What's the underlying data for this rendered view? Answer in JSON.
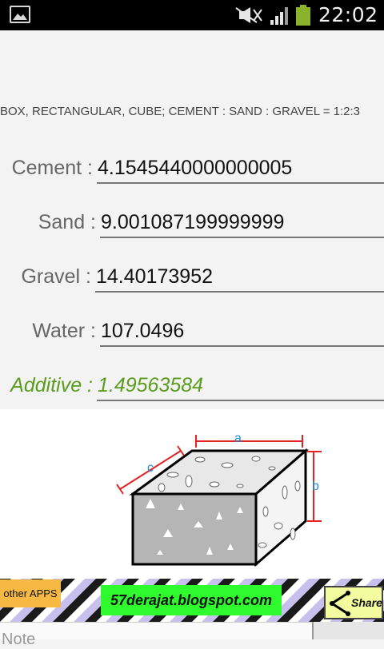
{
  "status_bar": {
    "time": "22:02",
    "battery_color": "#8ab32b",
    "icons": [
      "gallery-icon",
      "mute-icon",
      "signal-icon",
      "battery-icon"
    ]
  },
  "header": {
    "text": "BOX, RECTANGULAR, CUBE; CEMENT : SAND : GRAVEL = 1:2:3"
  },
  "results": {
    "cement": {
      "label": "Cement :",
      "value": "4.1545440000000005"
    },
    "sand": {
      "label": "Sand :",
      "value": "9.001087199999999"
    },
    "gravel": {
      "label": "Gravel :",
      "value": "14.40173952"
    },
    "water": {
      "label": "Water :",
      "value": "107.0496"
    },
    "additive": {
      "label": "Additive :",
      "value": "1.49563584"
    }
  },
  "diagram": {
    "label_a": "a",
    "label_b": "b",
    "label_c": "c"
  },
  "ad_bar": {
    "other_apps": "other APPS",
    "blog": "57derajat.blogspot.com",
    "share": "Share"
  },
  "note": {
    "placeholder": "Note"
  },
  "colors": {
    "accent_green": "#5b9c1c",
    "blog_bg": "#2efa2e",
    "other_apps_bg": "#f7b944",
    "share_bg": "#f3fc9e"
  }
}
